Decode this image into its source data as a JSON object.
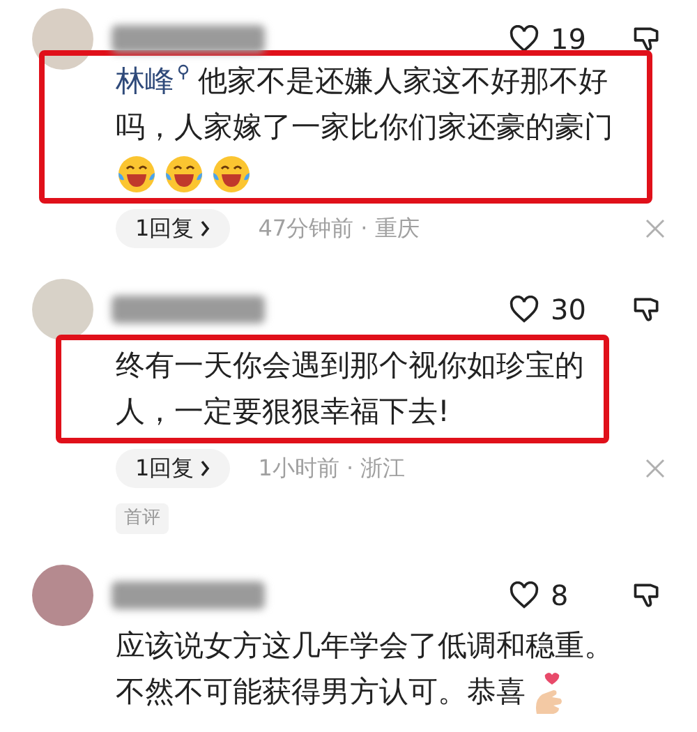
{
  "comments": [
    {
      "likes": "19",
      "highlighted": true,
      "mention": "林峰",
      "lines": [
        "他家不是还嫌人家这不好那不好",
        "吗，人家嫁了一家比你们家还豪的豪门"
      ],
      "emojis": [
        {
          "kind": "laughing"
        },
        {
          "kind": "laughing"
        },
        {
          "kind": "laughing"
        }
      ],
      "replies": "1回复",
      "meta": "47分钟前 · 重庆"
    },
    {
      "likes": "30",
      "highlighted": true,
      "lines": [
        "终有一天你会遇到那个视你如珍宝的",
        "人，一定要狠狠幸福下去!"
      ],
      "replies": "1回复",
      "meta": "1小时前 · 浙江",
      "tag": "首评"
    },
    {
      "likes": "8",
      "highlighted": false,
      "lines": [
        "应该说女方这几年学会了低调和稳重。",
        "不然不可能获得男方认可。恭喜"
      ],
      "emojis": [
        {
          "kind": "finger-heart"
        }
      ]
    }
  ]
}
